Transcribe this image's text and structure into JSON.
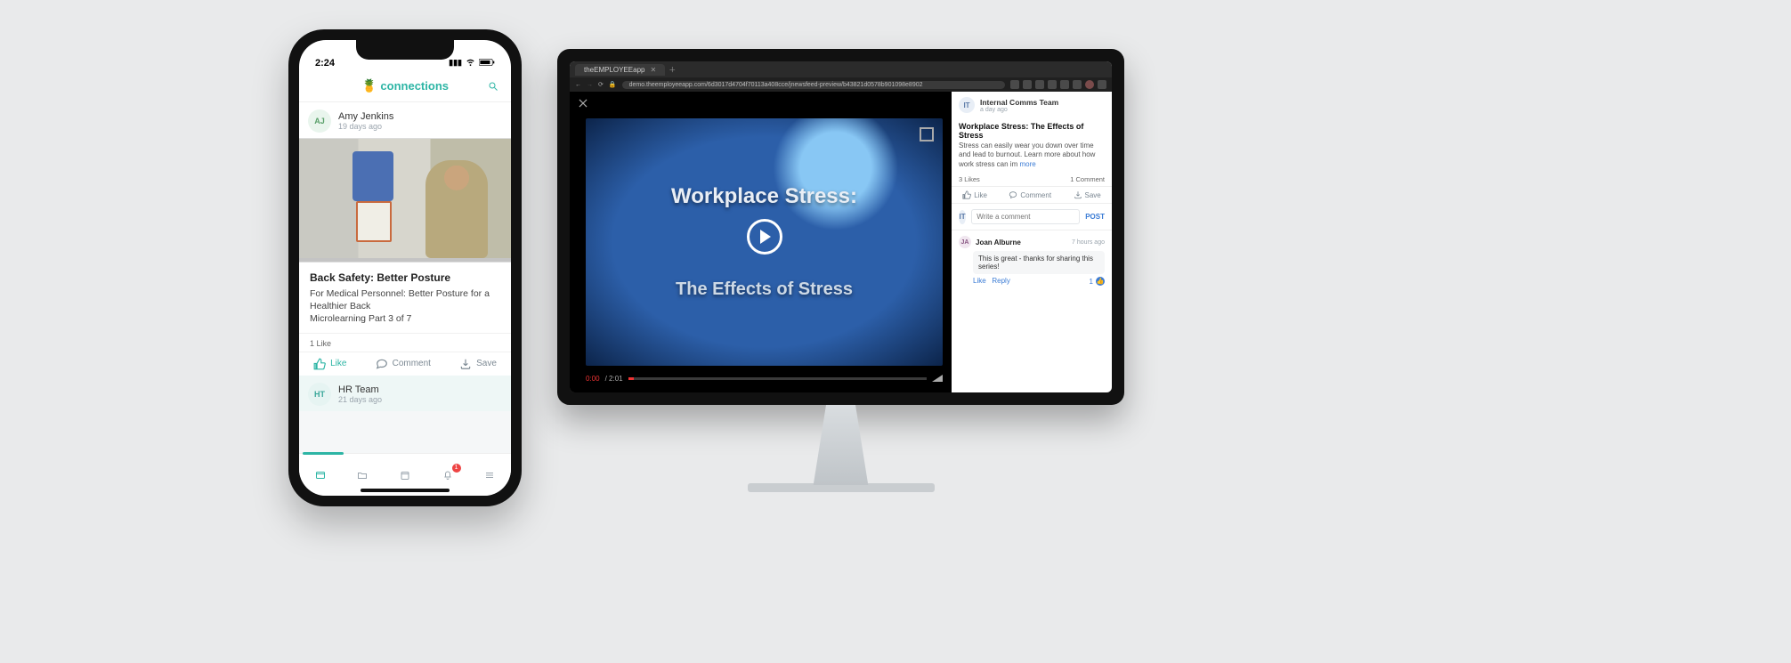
{
  "phone": {
    "time": "2:24",
    "app_name": "connections",
    "post1": {
      "avatar": "AJ",
      "author": "Amy Jenkins",
      "ago": "19 days ago",
      "title": "Back Safety: Better Posture",
      "desc_line1": "For Medical Personnel: Better Posture for a Healthier Back",
      "desc_line2": "Microlearning Part 3 of 7",
      "likes": "1 Like",
      "like_label": "Like",
      "comment_label": "Comment",
      "save_label": "Save"
    },
    "post2": {
      "avatar": "HT",
      "author": "HR Team",
      "ago": "21 days ago"
    },
    "notif_badge": "1"
  },
  "desktop": {
    "tab_title": "theEMPLOYEEapp",
    "url": "demo.theemployeeapp.com/6d3017d4704f70113a408cce/jnewsfeed-preview/b43821d0578b901098e8902",
    "video": {
      "title_a": "Workplace Stress:",
      "title_b": "The Effects of Stress",
      "t0": "0:00",
      "dur": "/ 2:01"
    },
    "panel": {
      "poster_avatar": "IT",
      "poster_name": "Internal Comms Team",
      "poster_ago": "a day ago",
      "title": "Workplace Stress: The Effects of Stress",
      "desc": "Stress can easily wear you down over time and lead to burnout. Learn more about how work stress can im",
      "more": "more",
      "likes": "3 Likes",
      "comments_count": "1 Comment",
      "like_label": "Like",
      "comment_label": "Comment",
      "save_label": "Save",
      "compose_placeholder": "Write a comment",
      "post_label": "POST",
      "comment": {
        "avatar": "JA",
        "name": "Joan Alburne",
        "ago": "7 hours ago",
        "body": "This is great - thanks for sharing this series!",
        "like_label": "Like",
        "reply_label": "Reply",
        "count": "1"
      }
    }
  }
}
